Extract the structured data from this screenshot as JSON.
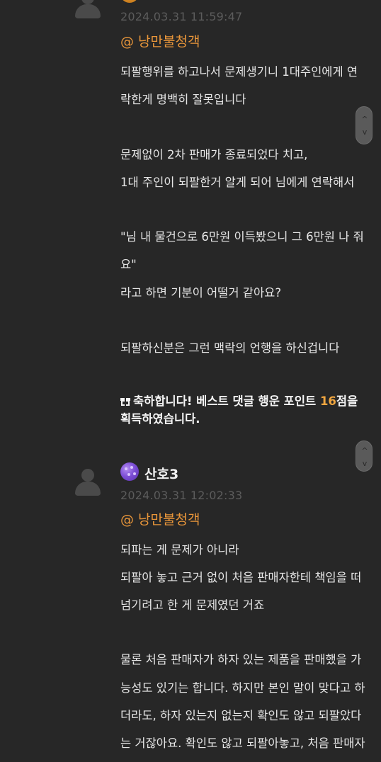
{
  "comments": [
    {
      "date": "2024.03.31 11:59:47",
      "mention": "@ 낭만불청객",
      "lines": [
        "되팔행위를 하고나서 문제생기니 1대주인에게 연",
        "락한게 명백히 잘못입니다",
        "문제없이 2차 판매가 종료되었다 치고,",
        "1대 주인이 되팔한거 알게 되어 님에게 연락해서",
        "\"님 내 물건으로 6만원 이득봤으니 그 6만원 나 줘",
        "요\"",
        "라고 하면 기분이 어떨거 같아요?",
        "되팔하신분은 그런 맥락의 언행을 하신겁니다"
      ],
      "notice": {
        "prefix": "축하합니다! 베스트 댓글 행운 포인트 ",
        "points": "16",
        "suffix": "점을",
        "line2": "획득하였습니다."
      }
    },
    {
      "nickname": "산호3",
      "date": "2024.03.31 12:02:33",
      "mention": "@ 낭만불청객",
      "lines": [
        "되파는 게 문제가 아니라",
        "되팔아 놓고 근거 없이 처음 판매자한테 책임을 떠",
        "넘기려고 한 게 문제였던 거죠",
        "물론 처음 판매자가 하자 있는 제품을 판매했을 가",
        "능성도 있기는 합니다. 하지만 본인 말이 맞다고 하",
        "더라도, 하자 있는지 없는지 확인도 않고 되팔았다",
        "는 거잖아요. 확인도 않고 되팔아놓고, 처음 판매자"
      ]
    }
  ],
  "scroll_buttons": {
    "up": "^",
    "down": "v"
  },
  "icons": {
    "avatar": "user-avatar-icon",
    "gift": "gift-icon",
    "level": "level-badge-icon"
  },
  "colors": {
    "background": "#272727",
    "mention": "#e9963a",
    "points": "#f0a640",
    "date": "#5c5c5c"
  }
}
